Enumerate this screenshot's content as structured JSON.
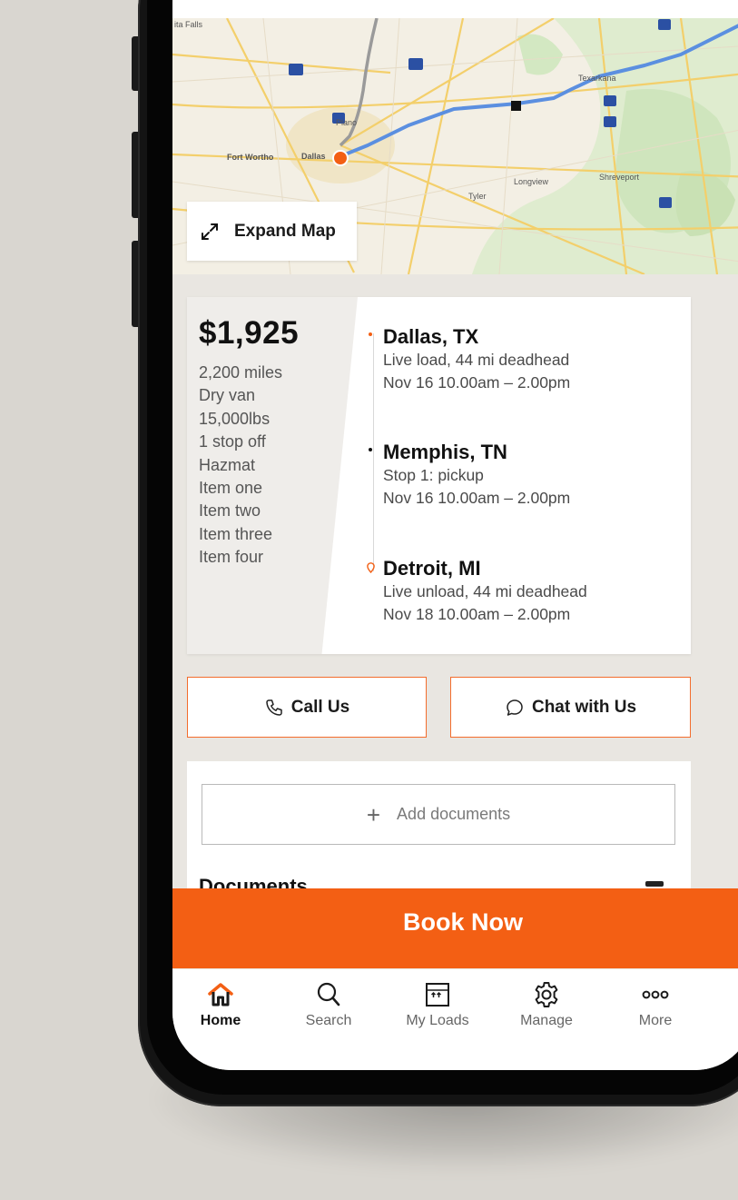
{
  "map": {
    "expand_label": "Expand Map",
    "places": {
      "fort_worth": "Fort Wortho",
      "dallas": "Dallas",
      "plano": "Plano",
      "longview": "Longview",
      "tyler": "Tyler",
      "shreveport": "Shreveport",
      "texarkana": "Texarkana",
      "wichita_falls": "ita Falls"
    },
    "route_color": "#5b8fe0",
    "origin_color": "#f35f14"
  },
  "load": {
    "price": "$1,925",
    "specs": [
      "2,200 miles",
      "Dry van",
      "15,000lbs",
      "1 stop off",
      "Hazmat",
      "Item one",
      "Item two",
      "Item three",
      "Item four"
    ],
    "stops": [
      {
        "city": "Dallas, TX",
        "detail": "Live load, 44 mi deadhead",
        "time": "Nov 16  10.00am – 2.00pm"
      },
      {
        "city": "Memphis, TN",
        "detail": "Stop 1: pickup",
        "time": "Nov 16  10.00am – 2.00pm"
      },
      {
        "city": "Detroit, MI",
        "detail": "Live unload, 44 mi deadhead",
        "time": "Nov 18  10.00am – 2.00pm"
      }
    ]
  },
  "actions": {
    "call_label": "Call Us",
    "chat_label": "Chat with Us"
  },
  "documents": {
    "add_label": "Add documents",
    "title": "Documents"
  },
  "book_label": "Book Now",
  "tabs": [
    {
      "label": "Home",
      "icon": "home-icon"
    },
    {
      "label": "Search",
      "icon": "search-icon"
    },
    {
      "label": "My Loads",
      "icon": "loads-icon"
    },
    {
      "label": "Manage",
      "icon": "gear-icon"
    },
    {
      "label": "More",
      "icon": "more-icon"
    }
  ],
  "colors": {
    "accent": "#f35f14",
    "button_border": "#f36d2d"
  }
}
